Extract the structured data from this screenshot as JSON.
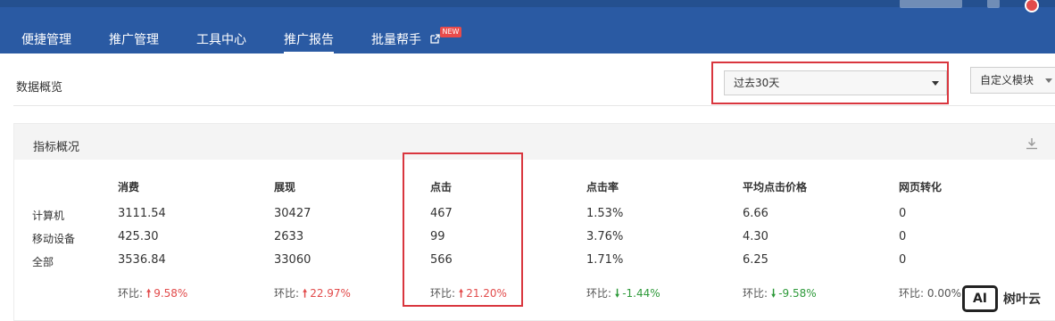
{
  "nav": {
    "items": [
      {
        "label": "便捷管理"
      },
      {
        "label": "推广管理"
      },
      {
        "label": "工具中心"
      },
      {
        "label": "推广报告"
      },
      {
        "label": "批量帮手",
        "badge": "NEW"
      }
    ],
    "active": "推广报告"
  },
  "toolbar": {
    "title": "数据概览",
    "date_range": "过去30天",
    "custom_module": "自定义模块"
  },
  "panel": {
    "title": "指标概况",
    "columns": [
      "消费",
      "展现",
      "点击",
      "点击率",
      "平均点击价格",
      "网页转化"
    ],
    "rows": [
      {
        "label": "计算机",
        "values": [
          "3111.54",
          "30427",
          "467",
          "1.53%",
          "6.66",
          "0"
        ]
      },
      {
        "label": "移动设备",
        "values": [
          "425.30",
          "2633",
          "99",
          "3.76%",
          "4.30",
          "0"
        ]
      },
      {
        "label": "全部",
        "values": [
          "3536.84",
          "33060",
          "566",
          "1.71%",
          "6.25",
          "0"
        ]
      }
    ],
    "ratio_prefix": "环比:",
    "ratios": [
      {
        "value": "9.58%",
        "direction": "up"
      },
      {
        "value": "22.97%",
        "direction": "up"
      },
      {
        "value": "21.20%",
        "direction": "up"
      },
      {
        "value": "-1.44%",
        "direction": "down"
      },
      {
        "value": "-9.58%",
        "direction": "down"
      },
      {
        "value": "0.00%",
        "direction": "none"
      }
    ]
  },
  "watermark": {
    "logo": "AI",
    "text": "树叶云"
  },
  "colors": {
    "header": "#2a5aa3",
    "highlight": "#d9363e",
    "up": "#e24b4b",
    "down": "#2e9a3a"
  }
}
